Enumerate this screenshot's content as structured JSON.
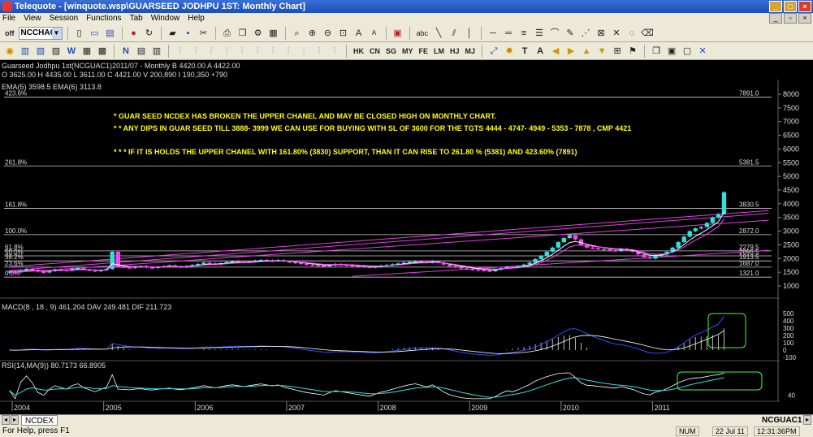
{
  "window": {
    "app_name": "Telequote",
    "title": "Telequote - [winquote.wsp\\GUARSEED JODHPU 1ST: Monthly Chart]"
  },
  "menu": [
    "File",
    "View",
    "Session",
    "Functions",
    "Tab",
    "Window",
    "Help"
  ],
  "toolbar": {
    "off_label": "off",
    "symbol_combo": "NCCHAQ",
    "text_tool": "abc",
    "font_up": "A",
    "font_down": "A",
    "period_buttons": [
      "HK",
      "CN",
      "SG",
      "MY",
      "FE",
      "LM",
      "HJ",
      "MJ"
    ],
    "text_button": "T",
    "big_a": "A",
    "w_button": "W",
    "n_button": "N"
  },
  "chart": {
    "header_line1": "Guarseed Jodhpu 1st(NCGUAC1)2011/07  - Monthly B 4420.00 A 4422.00",
    "header_line2": "O 3625.00 H 4435.00 L 3611.00 C 4421.00 V 200,890 I 190,350 +790",
    "ema_label": "EMA(5) 3598.5  EMA(6) 3113.8",
    "annotations": [
      "* GUAR SEED NCDEX HAS BROKEN THE UPPER CHANEL AND MAY BE CLOSED HIGH ON MONTHLY CHART.",
      "* * ANY DIPS IN GUAR SEED TILL 3888- 3999 WE CAN USE FOR BUYING WITH SL OF 3600 FOR THE TGTS 4444 - 4747- 4949 - 5353 - 7878  , CMP 4421",
      "* * * IF IT IS HOLDS THE UPPER CHANEL WITH 161.80% (3830) SUPPORT, THAN IT CAN RISE TO 261.80 % (5381) AND 423.60% (7891)"
    ],
    "fib_levels": [
      {
        "pct": "423.6%",
        "value": "7891.0",
        "price": 7891
      },
      {
        "pct": "261.8%",
        "value": "5381.5",
        "price": 5381.5
      },
      {
        "pct": "161.8%",
        "value": "3830.5",
        "price": 3830.5
      },
      {
        "pct": "100.0%",
        "value": "2872.0",
        "price": 2872
      },
      {
        "pct": "61.8%",
        "value": "2279.5",
        "price": 2279.5
      },
      {
        "pct": "50.0%",
        "value": "2096.5",
        "price": 2096.5
      },
      {
        "pct": "38.2%",
        "value": "1913.5",
        "price": 1913.5
      },
      {
        "pct": "23.6%",
        "value": "1687.0",
        "price": 1687
      },
      {
        "pct": "0.0%",
        "value": "1321.0",
        "price": 1321
      }
    ],
    "y_ticks": [
      "8000",
      "7500",
      "7000",
      "6500",
      "6000",
      "5500",
      "5000",
      "4500",
      "4000",
      "3500",
      "3000",
      "2500",
      "2000",
      "1500",
      "1000"
    ],
    "y_tick_values": [
      8000,
      7500,
      7000,
      6500,
      6000,
      5500,
      5000,
      4500,
      4000,
      3500,
      3000,
      2500,
      2000,
      1500,
      1000
    ],
    "macd_label": "MACD(8 , 18 , 9)  461.204  DAV  249.481  DIF  211.723",
    "macd_ticks": [
      "500",
      "400",
      "300",
      "200",
      "100",
      "0",
      "-100"
    ],
    "macd_tick_values": [
      500,
      400,
      300,
      200,
      100,
      0,
      -100
    ],
    "rsi_label": "RSI(14,MA(9))  80.7173   66.8905",
    "rsi_ticks": [
      "40"
    ],
    "rsi_tick_values": [
      40
    ],
    "x_labels": [
      "2004",
      "2005",
      "2006",
      "2007",
      "2008",
      "2009",
      "2010",
      "2011"
    ],
    "colors": {
      "bull": "#30e0e0",
      "bear": "#ff40ff",
      "fib_line": "#ffffff",
      "channel": "#e040e0",
      "annotation": "#ffff00",
      "ema_a": "#ffffff",
      "ema_b": "#ff40ff",
      "macd_line": "#3050ff",
      "highlight": "#40ff40"
    }
  },
  "chart_data": {
    "type": "candlestick",
    "title": "Guarseed Jodhpu 1st(NCGUAC1)2011/07  - Monthly",
    "ylim": [
      1000,
      8000
    ],
    "x_labels": [
      "2004",
      "2005",
      "2006",
      "2007",
      "2008",
      "2009",
      "2010",
      "2011"
    ],
    "closes": [
      1530,
      1500,
      1560,
      1620,
      1590,
      1520,
      1490,
      1550,
      1600,
      1580,
      1560,
      1620,
      1650,
      1600,
      1570,
      1540,
      1580,
      1620,
      2250,
      1700,
      1680,
      1660,
      1700,
      1720,
      1680,
      1660,
      1700,
      1720,
      1750,
      1710,
      1690,
      1720,
      1760,
      1800,
      1850,
      1820,
      1790,
      1830,
      1870,
      1900,
      1880,
      1860,
      1890,
      1920,
      1950,
      1930,
      1910,
      1940,
      1900,
      1870,
      1840,
      1810,
      1780,
      1760,
      1740,
      1720,
      1760,
      1800,
      1780,
      1760,
      1740,
      1720,
      1700,
      1680,
      1710,
      1740,
      1760,
      1790,
      1820,
      1850,
      1880,
      1900,
      1880,
      1860,
      1900,
      1850,
      1780,
      1720,
      1680,
      1640,
      1620,
      1600,
      1580,
      1560,
      1540,
      1600,
      1650,
      1700,
      1680,
      1720,
      1780,
      1850,
      1980,
      2100,
      2250,
      2400,
      2600,
      2750,
      2850,
      2700,
      2500,
      2400,
      2380,
      2350,
      2330,
      2300,
      2280,
      2350,
      2300,
      2250,
      2150,
      2050,
      2000,
      2100,
      2150,
      2250,
      2400,
      2600,
      2800,
      3000,
      3100,
      3150,
      3300,
      3500,
      3625,
      4421
    ],
    "macd": {
      "value": 461.204,
      "dav": 249.481,
      "dif": 211.723
    },
    "rsi": {
      "value": 80.7173,
      "ma": 66.8905
    }
  },
  "tabs": {
    "active_tab": "NCDEX",
    "symbol": "NCGUAC1"
  },
  "status": {
    "help_text": "For Help, press F1",
    "num": "NUM",
    "date": "22 Jul 11",
    "time": "12:31:36PM"
  }
}
